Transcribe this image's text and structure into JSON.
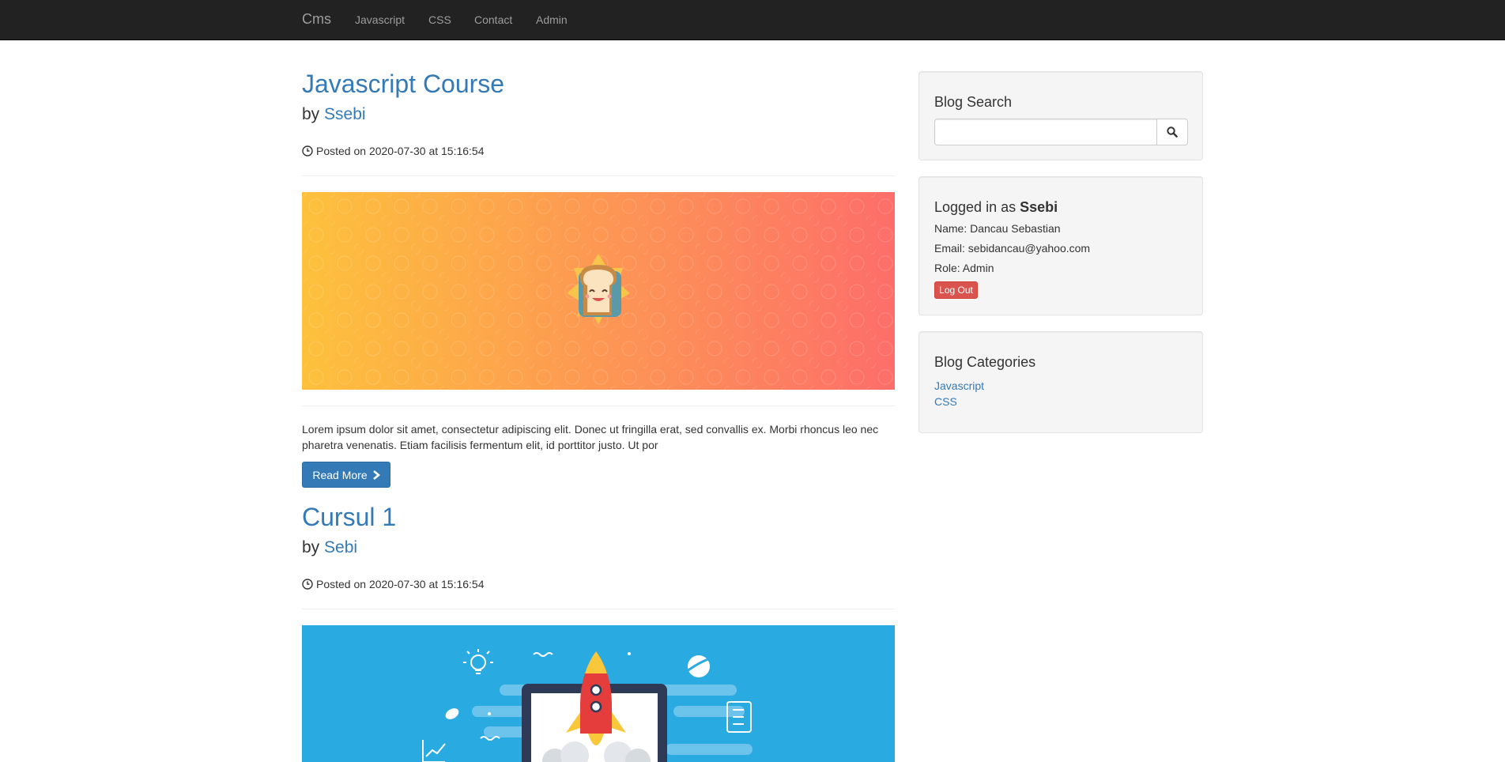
{
  "navbar": {
    "brand": "Cms",
    "links": [
      "Javascript",
      "CSS",
      "Contact",
      "Admin"
    ]
  },
  "posts": [
    {
      "title": "Javascript Course",
      "by_prefix": "by",
      "author": "Ssebi",
      "date_text": "Posted on 2020-07-30 at 15:16:54",
      "excerpt": "Lorem ipsum dolor sit amet, consectetur adipiscing elit. Donec ut fringilla erat, sed convallis ex. Morbi rhoncus leo nec pharetra venenatis. Etiam facilisis fermentum elit, id porttitor justo. Ut por",
      "read_more": "Read More",
      "image": {
        "type": "toast-banner",
        "gradient_from": "#fdc13c",
        "gradient_to": "#fd6e6a"
      }
    },
    {
      "title": "Cursul 1",
      "by_prefix": "by",
      "author": "Sebi",
      "date_text": "Posted on 2020-07-30 at 15:16:54",
      "image": {
        "type": "rocket-banner",
        "background": "#29abe2"
      }
    }
  ],
  "sidebar": {
    "search": {
      "heading": "Blog Search",
      "value": "",
      "button_icon": "search-icon"
    },
    "user": {
      "heading_prefix": "Logged in as",
      "username": "Ssebi",
      "name_line": "Name: Dancau Sebastian",
      "email_line": "Email: sebidancau@yahoo.com",
      "role_line": "Role: Admin",
      "logout_label": "Log Out"
    },
    "categories": {
      "heading": "Blog Categories",
      "items": [
        "Javascript",
        "CSS"
      ]
    }
  },
  "colors": {
    "link": "#337ab7",
    "navbar_bg": "#222222",
    "navbar_text": "#9d9d9d",
    "danger": "#d9534f",
    "well_bg": "#f5f5f5"
  }
}
